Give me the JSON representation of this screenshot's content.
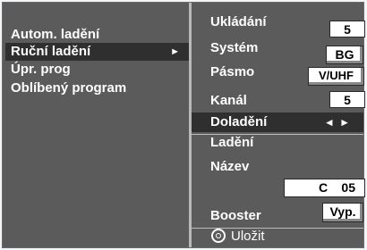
{
  "menu": {
    "items": [
      {
        "label": "Autom. ladění",
        "selected": false
      },
      {
        "label": "Ruční ladění",
        "selected": true,
        "arrow": "►"
      },
      {
        "label": "Úpr. prog",
        "selected": false
      },
      {
        "label": "Oblíbený program",
        "selected": false
      }
    ]
  },
  "settings": {
    "ukladani": {
      "label": "Ukládání",
      "value": "5"
    },
    "system": {
      "label": "Systém",
      "value": "BG"
    },
    "pasmo": {
      "label": "Pásmo",
      "value": "V/UHF"
    },
    "kanal": {
      "label": "Kanál",
      "value": "5"
    },
    "doladeni": {
      "label": "Doladění",
      "arrows": "◄ ►",
      "selected": true
    },
    "ladeni": {
      "label": "Ladění"
    },
    "nazev": {
      "label": "Název",
      "channel_letter": "C",
      "channel_number": "05"
    },
    "booster": {
      "label": "Booster",
      "value": "Vyp."
    }
  },
  "footer": {
    "save_label": "Uložit",
    "icon": "ok-circle-icon"
  },
  "colors": {
    "panel": "#5b5b5b",
    "highlight": "#2f2f2f",
    "value_bg": "#ffffff",
    "text": "#ffffff"
  }
}
